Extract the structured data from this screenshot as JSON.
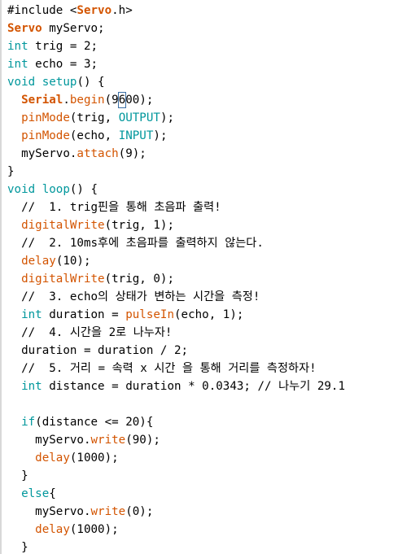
{
  "editor": {
    "lines": [
      [
        {
          "t": "#include <",
          "c": "plain"
        },
        {
          "t": "Servo",
          "c": "fn-bold"
        },
        {
          "t": ".h>",
          "c": "plain"
        }
      ],
      [
        {
          "t": "Servo",
          "c": "fn-bold"
        },
        {
          "t": " myServo;",
          "c": "plain"
        }
      ],
      [
        {
          "t": "int",
          "c": "kw"
        },
        {
          "t": " trig = 2;",
          "c": "plain"
        }
      ],
      [
        {
          "t": "int",
          "c": "kw"
        },
        {
          "t": " echo = 3;",
          "c": "plain"
        }
      ],
      [
        {
          "t": "void",
          "c": "kw"
        },
        {
          "t": " ",
          "c": "plain"
        },
        {
          "t": "setup",
          "c": "kw"
        },
        {
          "t": "() {",
          "c": "plain"
        }
      ],
      [
        {
          "t": "  ",
          "c": "plain"
        },
        {
          "t": "Serial",
          "c": "fn-bold"
        },
        {
          "t": ".",
          "c": "plain"
        },
        {
          "t": "begin",
          "c": "fn"
        },
        {
          "t": "(9",
          "c": "plain"
        },
        {
          "t": "6",
          "c": "cursor"
        },
        {
          "t": "00);",
          "c": "plain"
        }
      ],
      [
        {
          "t": "  ",
          "c": "plain"
        },
        {
          "t": "pinMode",
          "c": "fn"
        },
        {
          "t": "(trig, ",
          "c": "plain"
        },
        {
          "t": "OUTPUT",
          "c": "kw"
        },
        {
          "t": ");",
          "c": "plain"
        }
      ],
      [
        {
          "t": "  ",
          "c": "plain"
        },
        {
          "t": "pinMode",
          "c": "fn"
        },
        {
          "t": "(echo, ",
          "c": "plain"
        },
        {
          "t": "INPUT",
          "c": "kw"
        },
        {
          "t": ");",
          "c": "plain"
        }
      ],
      [
        {
          "t": "  myServo.",
          "c": "plain"
        },
        {
          "t": "attach",
          "c": "fn"
        },
        {
          "t": "(9);",
          "c": "plain"
        }
      ],
      [
        {
          "t": "}",
          "c": "plain"
        }
      ],
      [
        {
          "t": "void",
          "c": "kw"
        },
        {
          "t": " ",
          "c": "plain"
        },
        {
          "t": "loop",
          "c": "kw"
        },
        {
          "t": "() {",
          "c": "plain"
        }
      ],
      [
        {
          "t": "  //  1. trig핀을 통해 초음파 출력!",
          "c": "plain"
        }
      ],
      [
        {
          "t": "  ",
          "c": "plain"
        },
        {
          "t": "digitalWrite",
          "c": "fn"
        },
        {
          "t": "(trig, 1);",
          "c": "plain"
        }
      ],
      [
        {
          "t": "  //  2. 10ms후에 초음파를 출력하지 않는다.",
          "c": "plain"
        }
      ],
      [
        {
          "t": "  ",
          "c": "plain"
        },
        {
          "t": "delay",
          "c": "fn"
        },
        {
          "t": "(10);",
          "c": "plain"
        }
      ],
      [
        {
          "t": "  ",
          "c": "plain"
        },
        {
          "t": "digitalWrite",
          "c": "fn"
        },
        {
          "t": "(trig, 0);",
          "c": "plain"
        }
      ],
      [
        {
          "t": "  //  3. echo의 상태가 변하는 시간을 측정!",
          "c": "plain"
        }
      ],
      [
        {
          "t": "  ",
          "c": "plain"
        },
        {
          "t": "int",
          "c": "kw"
        },
        {
          "t": " duration = ",
          "c": "plain"
        },
        {
          "t": "pulseIn",
          "c": "fn"
        },
        {
          "t": "(echo, 1);",
          "c": "plain"
        }
      ],
      [
        {
          "t": "  //  4. 시간을 2로 나누자!",
          "c": "plain"
        }
      ],
      [
        {
          "t": "  duration = duration / 2;",
          "c": "plain"
        }
      ],
      [
        {
          "t": "  //  5. 거리 = 속력 x 시간 을 통해 거리를 측정하자!",
          "c": "plain"
        }
      ],
      [
        {
          "t": "  ",
          "c": "plain"
        },
        {
          "t": "int",
          "c": "kw"
        },
        {
          "t": " distance = duration * 0.0343; // 나누기 29.1",
          "c": "plain"
        }
      ],
      [
        {
          "t": "",
          "c": "plain"
        }
      ],
      [
        {
          "t": "  ",
          "c": "plain"
        },
        {
          "t": "if",
          "c": "kw"
        },
        {
          "t": "(distance <= 20){",
          "c": "plain"
        }
      ],
      [
        {
          "t": "    myServo.",
          "c": "plain"
        },
        {
          "t": "write",
          "c": "fn"
        },
        {
          "t": "(90);",
          "c": "plain"
        }
      ],
      [
        {
          "t": "    ",
          "c": "plain"
        },
        {
          "t": "delay",
          "c": "fn"
        },
        {
          "t": "(1000);",
          "c": "plain"
        }
      ],
      [
        {
          "t": "  }",
          "c": "plain"
        }
      ],
      [
        {
          "t": "  ",
          "c": "plain"
        },
        {
          "t": "else",
          "c": "kw"
        },
        {
          "t": "{",
          "c": "plain"
        }
      ],
      [
        {
          "t": "    myServo.",
          "c": "plain"
        },
        {
          "t": "write",
          "c": "fn"
        },
        {
          "t": "(0);",
          "c": "plain"
        }
      ],
      [
        {
          "t": "    ",
          "c": "plain"
        },
        {
          "t": "delay",
          "c": "fn"
        },
        {
          "t": "(1000);",
          "c": "plain"
        }
      ],
      [
        {
          "t": "  }",
          "c": "plain"
        }
      ]
    ]
  },
  "colors": {
    "keyword": "#00979c",
    "function": "#d35400",
    "text": "#000000",
    "background": "#ffffff"
  }
}
